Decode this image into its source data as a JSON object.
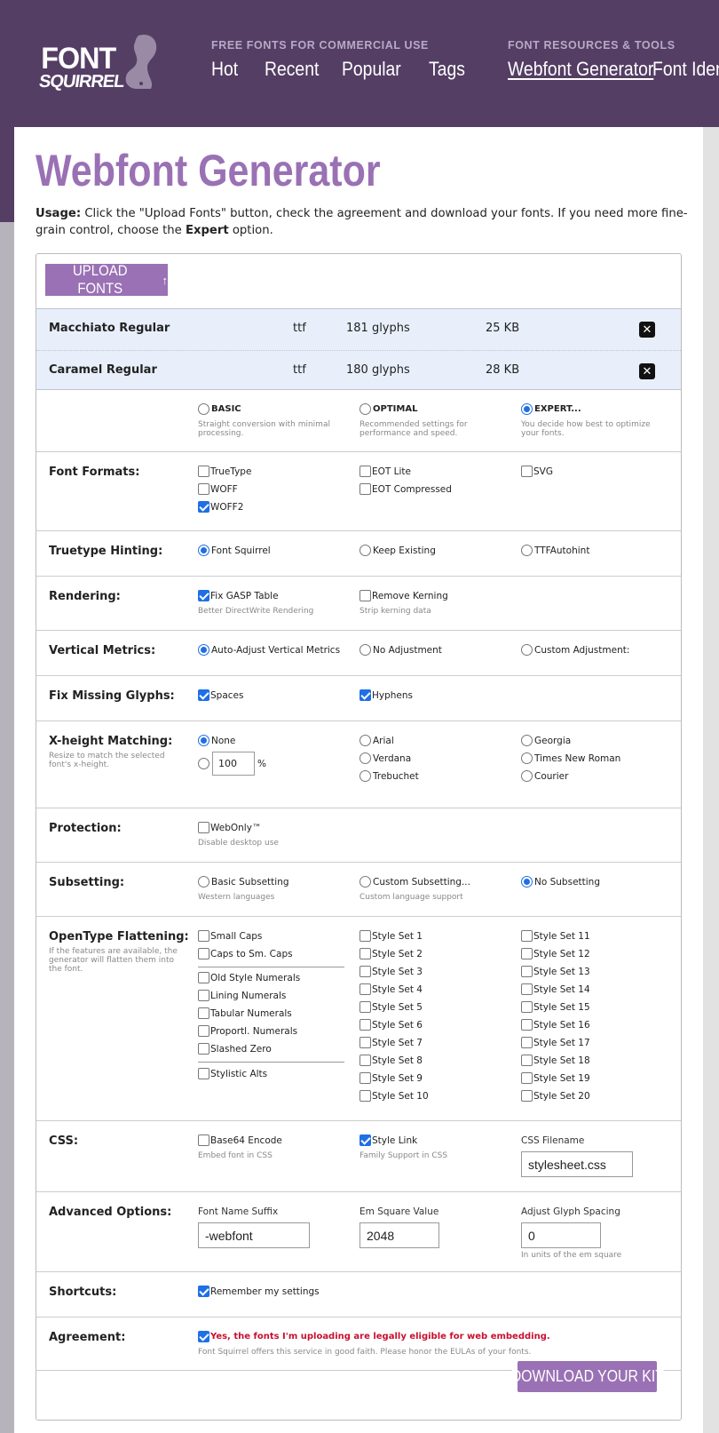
{
  "logo": {
    "line1": "FONT",
    "line2": "SQUIRREL"
  },
  "nav": {
    "free_caption": "FREE FONTS FOR COMMERCIAL USE",
    "free_links": [
      "Hot",
      "Recent",
      "Popular",
      "Tags"
    ],
    "tools_caption": "FONT RESOURCES & TOOLS",
    "tools_links": [
      "Webfont Generator",
      "Font Identifier"
    ]
  },
  "page": {
    "title": "Webfont Generator",
    "usage_label": "Usage:",
    "usage_text_1": " Click the \"Upload Fonts\" button, check the agreement and download your fonts. If you need more fine-grain control, choose the ",
    "usage_expert": "Expert",
    "usage_text_2": " option."
  },
  "upload_button": "UPLOAD FONTS",
  "files": [
    {
      "name": "Macchiato Regular",
      "type": "ttf",
      "glyphs": "181 glyphs",
      "size": "25 KB"
    },
    {
      "name": "Caramel Regular",
      "type": "ttf",
      "glyphs": "180 glyphs",
      "size": "28 KB"
    }
  ],
  "modes": [
    {
      "label": "BASIC",
      "hint": "Straight conversion with minimal processing.",
      "selected": false
    },
    {
      "label": "OPTIMAL",
      "hint": "Recommended settings for performance and speed.",
      "selected": false
    },
    {
      "label": "EXPERT...",
      "hint": "You decide how best to optimize your fonts.",
      "selected": true
    }
  ],
  "font_formats": {
    "label": "Font Formats:",
    "options": [
      {
        "label": "TrueType",
        "checked": false
      },
      {
        "label": "WOFF",
        "checked": false
      },
      {
        "label": "WOFF2",
        "checked": true
      },
      {
        "label": "EOT Lite",
        "checked": false
      },
      {
        "label": "EOT Compressed",
        "checked": false
      },
      {
        "label": "SVG",
        "checked": false
      }
    ]
  },
  "hinting": {
    "label": "Truetype Hinting:",
    "options": [
      {
        "label": "Font Squirrel",
        "selected": true
      },
      {
        "label": "Keep Existing",
        "selected": false
      },
      {
        "label": "TTFAutohint",
        "selected": false
      }
    ]
  },
  "rendering": {
    "label": "Rendering:",
    "options": [
      {
        "label": "Fix GASP Table",
        "hint": "Better DirectWrite Rendering",
        "checked": true
      },
      {
        "label": "Remove Kerning",
        "hint": "Strip kerning data",
        "checked": false
      }
    ]
  },
  "vertical": {
    "label": "Vertical Metrics:",
    "options": [
      {
        "label": "Auto-Adjust Vertical Metrics",
        "selected": true
      },
      {
        "label": "No Adjustment",
        "selected": false
      },
      {
        "label": "Custom Adjustment:",
        "selected": false
      }
    ]
  },
  "glyphs": {
    "label": "Fix Missing Glyphs:",
    "options": [
      {
        "label": "Spaces",
        "checked": true
      },
      {
        "label": "Hyphens",
        "checked": true
      }
    ]
  },
  "xheight": {
    "label": "X-height Matching:",
    "hint": "Resize to match the selected font's x-height.",
    "none_label": "None",
    "value": "100",
    "unit": "%",
    "fonts": [
      "Arial",
      "Verdana",
      "Trebuchet",
      "Georgia",
      "Times New Roman",
      "Courier"
    ]
  },
  "protection": {
    "label": "Protection:",
    "option": "WebOnly™",
    "hint": "Disable desktop use",
    "checked": false
  },
  "subsetting": {
    "label": "Subsetting:",
    "options": [
      {
        "label": "Basic Subsetting",
        "hint": "Western languages",
        "selected": false
      },
      {
        "label": "Custom Subsetting...",
        "hint": "Custom language support",
        "selected": false
      },
      {
        "label": "No Subsetting",
        "hint": "",
        "selected": true
      }
    ]
  },
  "opentype": {
    "label": "OpenType Flattening:",
    "hint": "If the features are available, the generator will flatten them into the font.",
    "group_a": [
      "Small Caps",
      "Caps to Sm. Caps"
    ],
    "group_b": [
      "Old Style Numerals",
      "Lining Numerals",
      "Tabular Numerals",
      "Proportl. Numerals",
      "Slashed Zero"
    ],
    "group_c": [
      "Stylistic Alts"
    ],
    "sets_1": [
      "Style Set 1",
      "Style Set 2",
      "Style Set 3",
      "Style Set 4",
      "Style Set 5",
      "Style Set 6",
      "Style Set 7",
      "Style Set 8",
      "Style Set 9",
      "Style Set 10"
    ],
    "sets_2": [
      "Style Set 11",
      "Style Set 12",
      "Style Set 13",
      "Style Set 14",
      "Style Set 15",
      "Style Set 16",
      "Style Set 17",
      "Style Set 18",
      "Style Set 19",
      "Style Set 20"
    ]
  },
  "css": {
    "label": "CSS:",
    "base64": {
      "label": "Base64 Encode",
      "hint": "Embed font in CSS",
      "checked": false
    },
    "style_link": {
      "label": "Style Link",
      "hint": "Family Support in CSS",
      "checked": true
    },
    "filename_label": "CSS Filename",
    "filename_value": "stylesheet.css"
  },
  "advanced": {
    "label": "Advanced Options:",
    "suffix_label": "Font Name Suffix",
    "suffix_value": "-webfont",
    "em_label": "Em Square Value",
    "em_value": "2048",
    "spacing_label": "Adjust Glyph Spacing",
    "spacing_value": "0",
    "spacing_hint": "In units of the em square"
  },
  "shortcuts": {
    "label": "Shortcuts:",
    "option": "Remember my settings",
    "checked": true
  },
  "agreement": {
    "label": "Agreement:",
    "option": "Yes, the fonts I'm uploading are legally eligible for web embedding.",
    "hint": "Font Squirrel offers this service in good faith. Please honor the EULAs of your fonts.",
    "checked": true
  },
  "download_button": "DOWNLOAD YOUR KIT",
  "colors": {
    "header": "#543e64",
    "accent": "#9a71b4",
    "checkbox": "#1f6fe5",
    "warning": "#c8102e"
  }
}
